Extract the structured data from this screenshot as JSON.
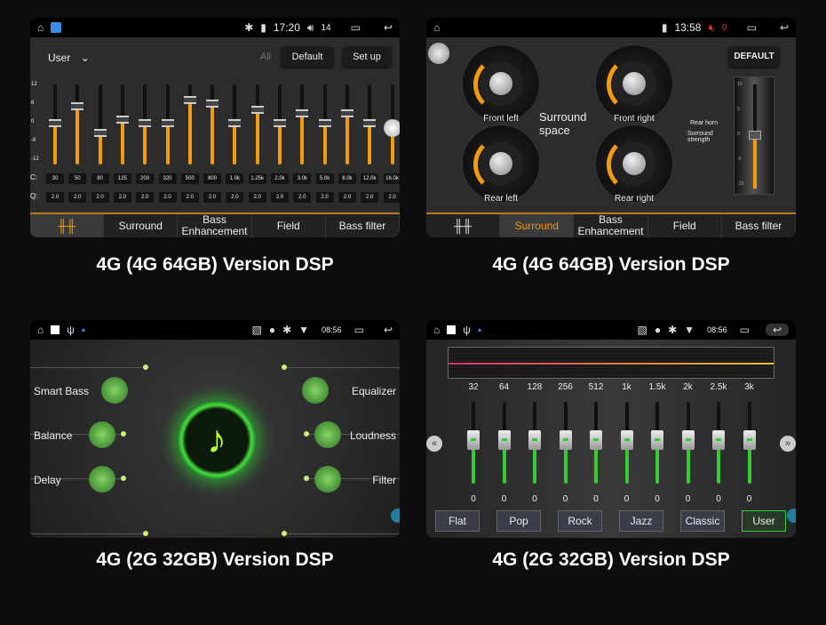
{
  "panel1": {
    "status": {
      "time": "17:20",
      "volume": "14"
    },
    "preset": "User",
    "all_label": "All",
    "default_label": "Default",
    "setup_label": "Set up",
    "scale": [
      "12",
      "6",
      "0",
      "-6",
      "-12"
    ],
    "fc_label": "C:",
    "q_label": "Q:",
    "bands": [
      {
        "fc": "30",
        "q": "2.0",
        "gain": 0
      },
      {
        "fc": "50",
        "q": "2.0",
        "gain": 5
      },
      {
        "fc": "80",
        "q": "2.0",
        "gain": -3
      },
      {
        "fc": "125",
        "q": "2.0",
        "gain": 1
      },
      {
        "fc": "200",
        "q": "2.0",
        "gain": 0
      },
      {
        "fc": "320",
        "q": "2.0",
        "gain": 0
      },
      {
        "fc": "500",
        "q": "2.0",
        "gain": 7
      },
      {
        "fc": "800",
        "q": "2.0",
        "gain": 6
      },
      {
        "fc": "1.0k",
        "q": "2.0",
        "gain": 0
      },
      {
        "fc": "1.25k",
        "q": "2.0",
        "gain": 4
      },
      {
        "fc": "2.0k",
        "q": "2.0",
        "gain": 0
      },
      {
        "fc": "3.0k",
        "q": "2.0",
        "gain": 3
      },
      {
        "fc": "5.0k",
        "q": "2.0",
        "gain": 0
      },
      {
        "fc": "8.0k",
        "q": "2.0",
        "gain": 3
      },
      {
        "fc": "12.0k",
        "q": "2.0",
        "gain": 0
      },
      {
        "fc": "16.0k",
        "q": "2.0",
        "gain": -1
      }
    ],
    "tabs": [
      "",
      "Surround",
      "Bass Enhancement",
      "Field",
      "Bass filter"
    ],
    "active_tab": 0
  },
  "panel2": {
    "status": {
      "time": "13:58",
      "volume": "0"
    },
    "default_label": "DEFAULT",
    "title": "Surround space",
    "gauges": [
      "Front left",
      "Front right",
      "Rear left",
      "Rear right"
    ],
    "rear_horn": "Rear horn",
    "strength": "Surround strength",
    "strength_scale": [
      "10",
      "5",
      "0",
      "-5",
      "-10"
    ],
    "strength_value": 0,
    "tabs": [
      "",
      "Surround",
      "Bass Enhancement",
      "Field",
      "Bass filter"
    ],
    "active_tab": 1
  },
  "panel3": {
    "status": {
      "time": "08:56"
    },
    "left": [
      "Smart Bass",
      "Balance",
      "Delay"
    ],
    "right": [
      "Equalizer",
      "Loudness",
      "Filter"
    ]
  },
  "panel4": {
    "status": {
      "time": "08:56"
    },
    "bands": [
      {
        "f": "32",
        "v": "0"
      },
      {
        "f": "64",
        "v": "0"
      },
      {
        "f": "128",
        "v": "0"
      },
      {
        "f": "256",
        "v": "0"
      },
      {
        "f": "512",
        "v": "0"
      },
      {
        "f": "1k",
        "v": "0"
      },
      {
        "f": "1.5k",
        "v": "0"
      },
      {
        "f": "2k",
        "v": "0"
      },
      {
        "f": "2.5k",
        "v": "0"
      },
      {
        "f": "3k",
        "v": "0"
      }
    ],
    "presets": [
      "Flat",
      "Pop",
      "Rock",
      "Jazz",
      "Classic",
      "User"
    ],
    "active_preset": "User"
  },
  "captions": [
    "4G (4G 64GB) Version DSP",
    "4G (4G 64GB) Version DSP",
    "4G (2G 32GB) Version DSP",
    "4G (2G 32GB) Version DSP"
  ],
  "colors": {
    "accent_orange": "#f39a12",
    "accent_green": "#33cc33"
  }
}
